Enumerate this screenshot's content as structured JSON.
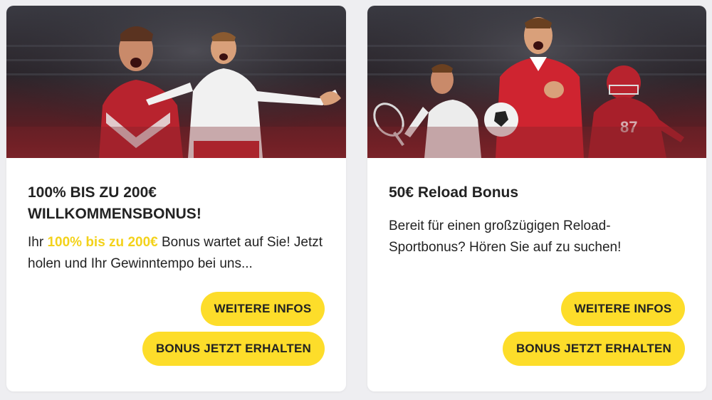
{
  "offers": [
    {
      "title": "100% BIS ZU 200€ WILLKOMMENSBONUS!",
      "desc_prefix": "Ihr ",
      "desc_highlight": "100% bis zu 200€",
      "desc_suffix": " Bonus wartet auf Sie! Jetzt holen und Ihr Gewinntempo bei uns...",
      "info_button": "WEITERE INFOS",
      "bonus_button": "BONUS JETZT ERHALTEN"
    },
    {
      "title": "50€ Reload Bonus",
      "desc": "Bereit für einen großzügigen Reload-Sportbonus? Hören Sie auf zu suchen!",
      "info_button": "WEITERE INFOS",
      "bonus_button": "BONUS JETZT ERHALTEN"
    }
  ],
  "colors": {
    "accent_yellow": "#fddd2a",
    "highlight_text": "#f3d21b",
    "hero_red": "#7a2228",
    "text_dark": "#222222"
  }
}
